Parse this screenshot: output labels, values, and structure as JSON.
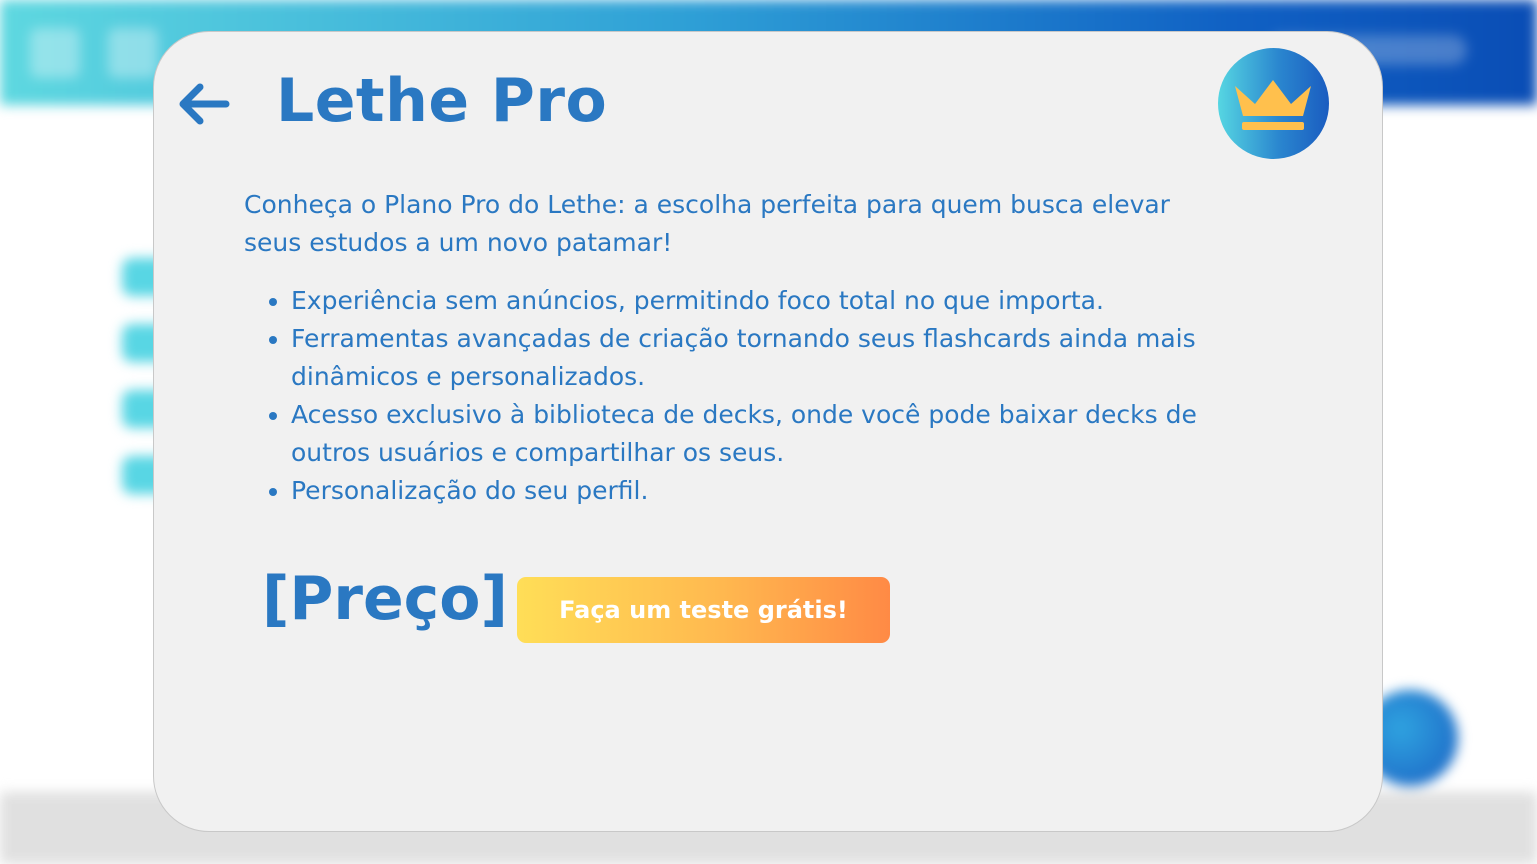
{
  "modal": {
    "title": "Lethe Pro",
    "intro": "Conheça o Plano Pro do Lethe: a escolha perfeita para quem busca elevar seus estudos a um novo patamar!",
    "features": [
      "Experiência sem anúncios, permitindo foco total no que importa.",
      "Ferramentas avançadas de criação tornando seus flashcards ainda mais dinâmicos e personalizados.",
      "Acesso exclusivo à biblioteca de decks, onde você pode baixar decks de outros usuários e compartilhar os seus.",
      "Personalização do seu perfil."
    ],
    "price": "[Preço]",
    "trial_button": "Faça um teste grátis!"
  },
  "icons": {
    "back": "arrow-left-icon",
    "badge": "crown-icon"
  },
  "colors": {
    "primary_text": "#2a78c2",
    "modal_bg": "#f1f1f1",
    "button_gradient_start": "#ffde57",
    "button_gradient_end": "#ff8a45",
    "crown": "#ffc04d"
  }
}
